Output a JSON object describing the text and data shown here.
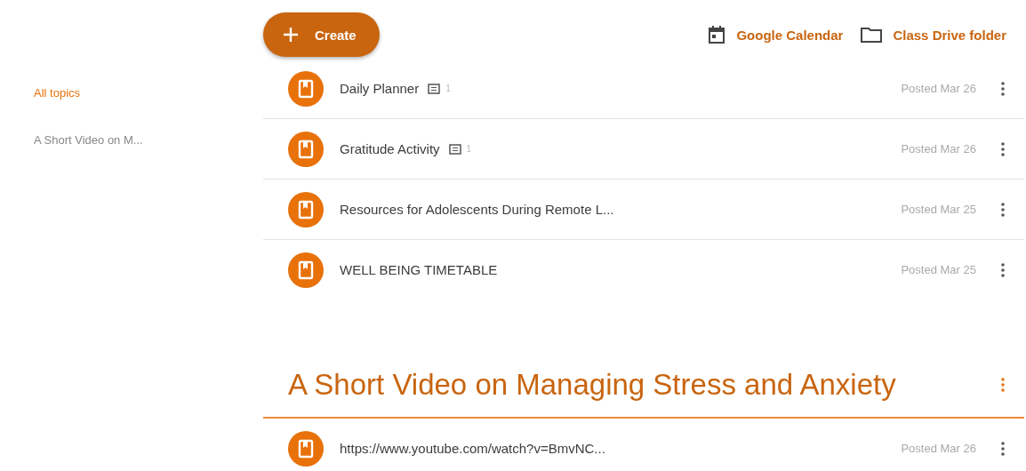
{
  "sidebar": {
    "items": [
      {
        "label": "All topics",
        "selected": true
      },
      {
        "label": "A Short Video on M...",
        "selected": false
      }
    ]
  },
  "toolbar": {
    "create_button": "Create",
    "links": [
      {
        "kind": "calendar",
        "label": "Google Calendar"
      },
      {
        "kind": "folder",
        "label": "Class Drive folder"
      }
    ]
  },
  "posts": [
    {
      "title": "Daily Planner",
      "comments": "1",
      "posted": "Posted Mar 26"
    },
    {
      "title": "Gratitude Activity",
      "comments": "1",
      "posted": "Posted Mar 26"
    },
    {
      "title": "Resources for Adolescents During Remote L...",
      "posted": "Posted Mar 25"
    },
    {
      "title": "WELL BEING TIMETABLE",
      "posted": "Posted Mar 25"
    }
  ],
  "topic": {
    "title": "A Short Video on Managing Stress and Anxiety",
    "posts": [
      {
        "title": "https://www.youtube.com/watch?v=BmvNC...",
        "posted": "Posted Mar 26"
      }
    ]
  }
}
